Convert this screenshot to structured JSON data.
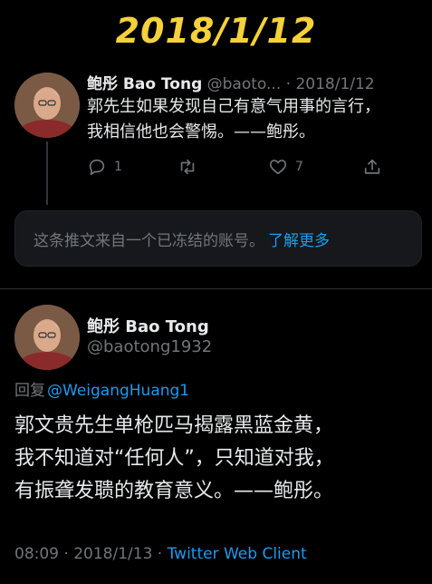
{
  "banner": {
    "date": "2018/1/12"
  },
  "tweet1": {
    "name": "鲍彤 Bao Tong",
    "handle": "@baoto...",
    "separator": " · ",
    "date": "2018/1/12",
    "text_line1": "郭先生如果发现自己有意气用事的言行，",
    "text_line2": "我相信他也会警惕。——鲍彤。",
    "reply_count": "1",
    "retweet_count": "",
    "like_count": "7"
  },
  "frozen_notice": {
    "text": "这条推文来自一个已冻结的账号。",
    "link": "了解更多"
  },
  "tweet2": {
    "name": "鲍彤 Bao Tong",
    "handle": "@baotong1932",
    "reply_prefix": "回复",
    "reply_to": "@WeigangHuang1",
    "text_line1": "郭文贵先生单枪匹马揭露黑蓝金黄，",
    "text_line2": "我不知道对“任何人”，只知道对我，",
    "text_line3": "有振聋发聩的教育意义。——鲍彤。",
    "time": "08:09",
    "date": "2018/1/13",
    "client": "Twitter Web Client",
    "separator": " · "
  },
  "icons": [
    "reply-icon",
    "retweet-icon",
    "like-icon",
    "share-icon"
  ],
  "colors": {
    "banner": "#f5d13a",
    "link": "#1d9bf0",
    "muted": "#71767b",
    "background": "#000000"
  }
}
